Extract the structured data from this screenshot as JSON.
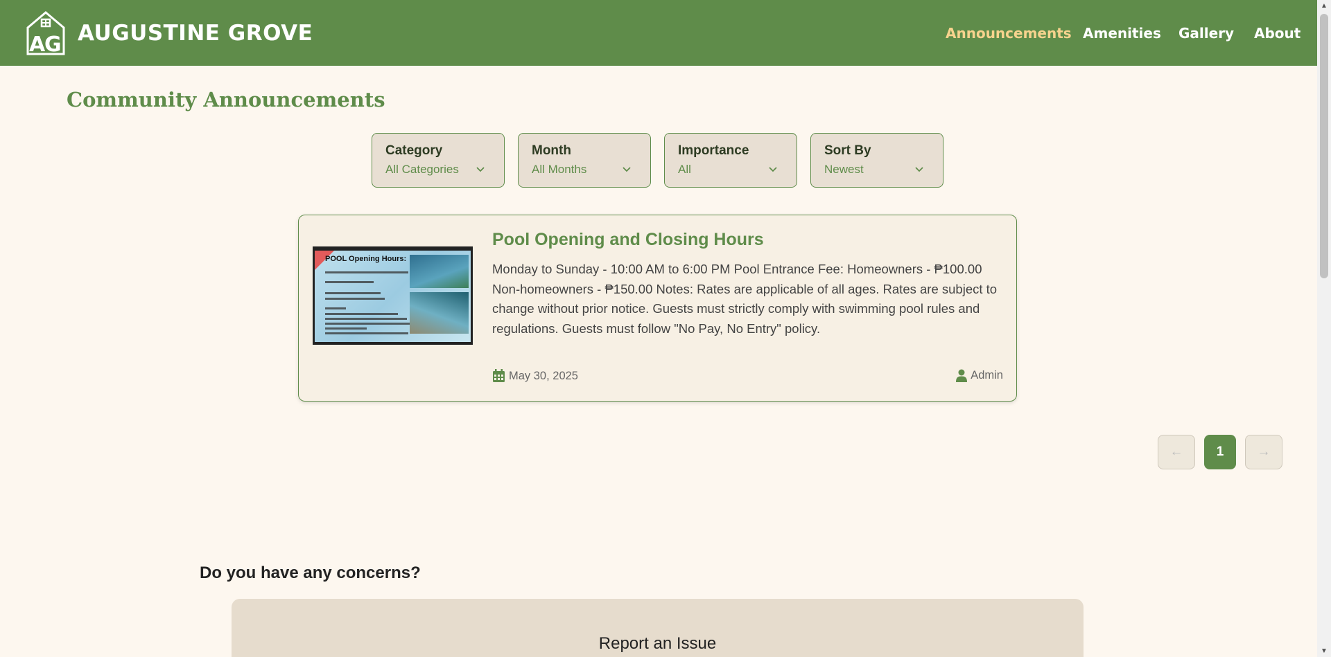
{
  "header": {
    "brand": "AUGUSTINE GROVE",
    "nav": [
      {
        "label": "Announcements",
        "active": true
      },
      {
        "label": "Amenities",
        "active": false
      },
      {
        "label": "Gallery",
        "active": false
      },
      {
        "label": "About",
        "active": false
      }
    ]
  },
  "page": {
    "title": "Community Announcements"
  },
  "filters": [
    {
      "label": "Category",
      "value": "All Categories"
    },
    {
      "label": "Month",
      "value": "All Months"
    },
    {
      "label": "Importance",
      "value": "All"
    },
    {
      "label": "Sort By",
      "value": "Newest"
    }
  ],
  "announcement": {
    "title": "Pool Opening and Closing Hours",
    "body": "Monday to Sunday - 10:00 AM to 6:00 PM Pool Entrance Fee: Homeowners - ₱100.00 Non-homeowners - ₱150.00 Notes: Rates are applicable of all ages. Rates are subject to change without prior notice. Guests must strictly comply with swimming pool rules and regulations. Guests must follow \"No Pay, No Entry\" policy.",
    "date": "May 30, 2025",
    "author": "Admin",
    "image_text": "POOL Opening Hours:"
  },
  "pagination": {
    "prev": "←",
    "current": "1",
    "next": "→"
  },
  "concerns": {
    "heading": "Do you have any concerns?",
    "report_title": "Report an Issue"
  },
  "colors": {
    "primary": "#5f8c4a",
    "nav_active": "#f7d38e",
    "background": "#fdf7ef",
    "filter_bg": "#e8dfd3",
    "card_bg": "#f7f0e4"
  },
  "icons": {
    "logo": "house-ag-logo-icon",
    "calendar": "calendar-icon",
    "user": "user-icon",
    "dropdown": "chevron-down-icon"
  }
}
